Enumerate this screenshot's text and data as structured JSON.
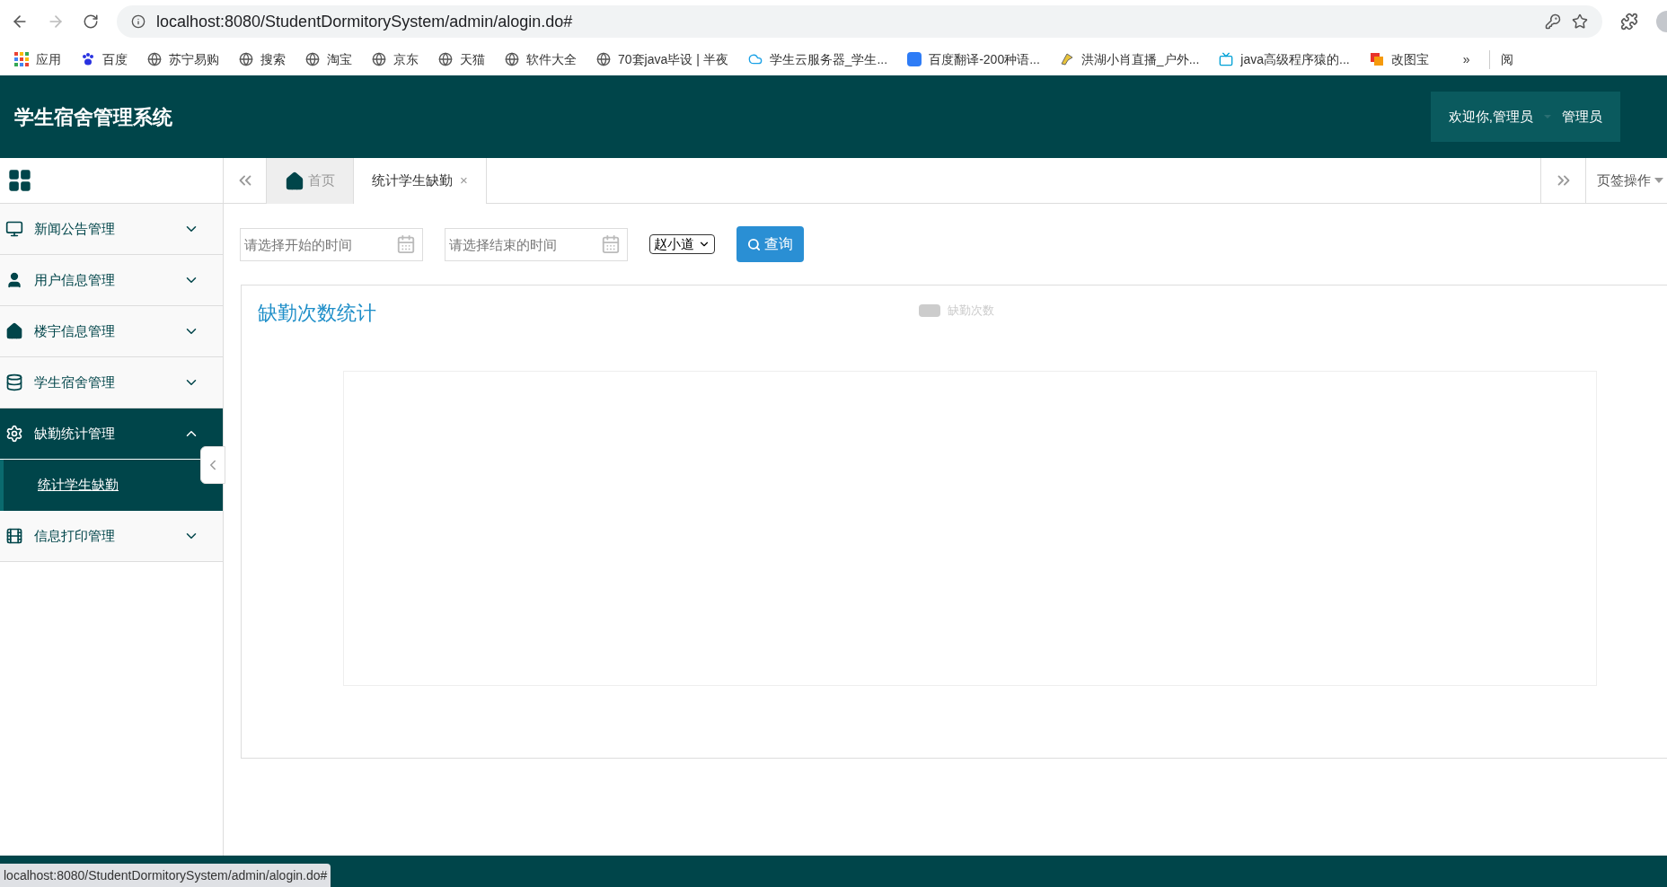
{
  "browser": {
    "url": "localhost:8080/StudentDormitorySystem/admin/alogin.do#",
    "bookmarks": [
      {
        "label": "应用",
        "kind": "apps"
      },
      {
        "label": "百度",
        "kind": "paw"
      },
      {
        "label": "苏宁易购",
        "kind": "globe"
      },
      {
        "label": "搜索",
        "kind": "globe"
      },
      {
        "label": "淘宝",
        "kind": "globe"
      },
      {
        "label": "京东",
        "kind": "globe"
      },
      {
        "label": "天猫",
        "kind": "globe"
      },
      {
        "label": "软件大全",
        "kind": "globe"
      },
      {
        "label": "70套java毕设 | 半夜",
        "kind": "globe"
      },
      {
        "label": "学生云服务器_学生...",
        "kind": "cloud"
      },
      {
        "label": "百度翻译-200种语...",
        "kind": "translate"
      },
      {
        "label": "洪湖小肖直播_户外...",
        "kind": "bird"
      },
      {
        "label": "java高级程序猿的...",
        "kind": "tv"
      },
      {
        "label": "改图宝",
        "kind": "squares"
      }
    ],
    "overflow": "»",
    "reading_list": "阅"
  },
  "header": {
    "title": "学生宿舍管理系统",
    "welcome": "欢迎你,管理员",
    "user": "管理员"
  },
  "sidebar": {
    "items": [
      {
        "label": "新闻公告管理",
        "expanded": false
      },
      {
        "label": "用户信息管理",
        "expanded": false
      },
      {
        "label": "楼宇信息管理",
        "expanded": false
      },
      {
        "label": "学生宿舍管理",
        "expanded": false
      },
      {
        "label": "缺勤统计管理",
        "expanded": true,
        "children": [
          {
            "label": "统计学生缺勤",
            "selected": true
          }
        ]
      },
      {
        "label": "信息打印管理",
        "expanded": false
      }
    ]
  },
  "tabs": [
    {
      "label": "首页",
      "kind": "home",
      "selected": false
    },
    {
      "label": "统计学生缺勤",
      "kind": "closable",
      "selected": true
    }
  ],
  "tab_close": "×",
  "tab_actions": "页签操作",
  "filters": {
    "start_placeholder": "请选择开始的时间",
    "end_placeholder": "请选择结束的时间",
    "student": "赵小道",
    "query_button": "查询"
  },
  "chart": {
    "title": "缺勤次数统计",
    "legend": "缺勤次数"
  },
  "status_tooltip": "localhost:8080/StudentDormitorySystem/admin/alogin.do#"
}
